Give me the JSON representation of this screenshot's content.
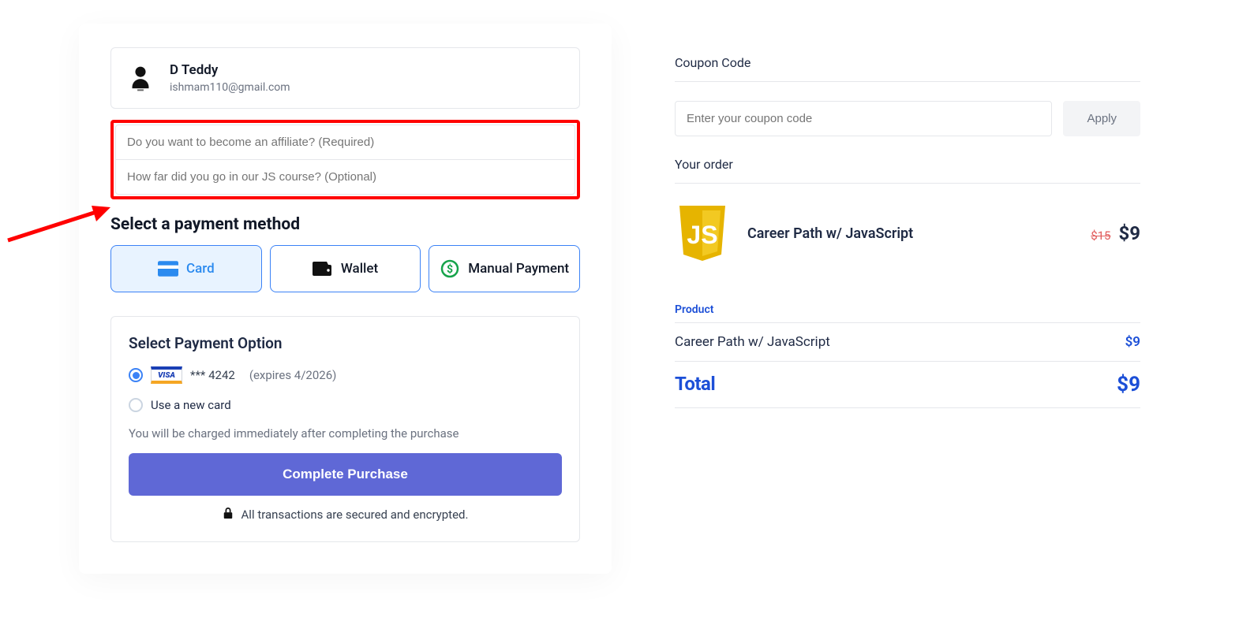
{
  "user": {
    "name": "D Teddy",
    "email": "ishmam110@gmail.com"
  },
  "questions": {
    "q1_placeholder": "Do you want to become an affiliate? (Required)",
    "q2_placeholder": "How far did you go in our JS course? (Optional)"
  },
  "payment_method": {
    "title": "Select a payment method",
    "options": [
      {
        "label": "Card",
        "active": true
      },
      {
        "label": "Wallet",
        "active": false
      },
      {
        "label": "Manual Payment",
        "active": false
      }
    ]
  },
  "payment_option": {
    "title": "Select Payment Option",
    "saved_card": {
      "brand": "VISA",
      "masked": "*** 4242",
      "expires": "(expires 4/2026)"
    },
    "new_card_label": "Use a new card",
    "charge_note": "You will be charged immediately after completing the purchase",
    "button": "Complete Purchase",
    "secure_note": "All transactions are secured and encrypted."
  },
  "coupon": {
    "label": "Coupon Code",
    "placeholder": "Enter your coupon code",
    "apply": "Apply"
  },
  "order": {
    "label": "Your order",
    "item": {
      "name": "Career Path w/ JavaScript",
      "old_price": "$15",
      "new_price": "$9"
    },
    "product_header": "Product",
    "rows": [
      {
        "name": "Career Path w/ JavaScript",
        "price": "$9"
      }
    ],
    "total_label": "Total",
    "total_price": "$9"
  }
}
